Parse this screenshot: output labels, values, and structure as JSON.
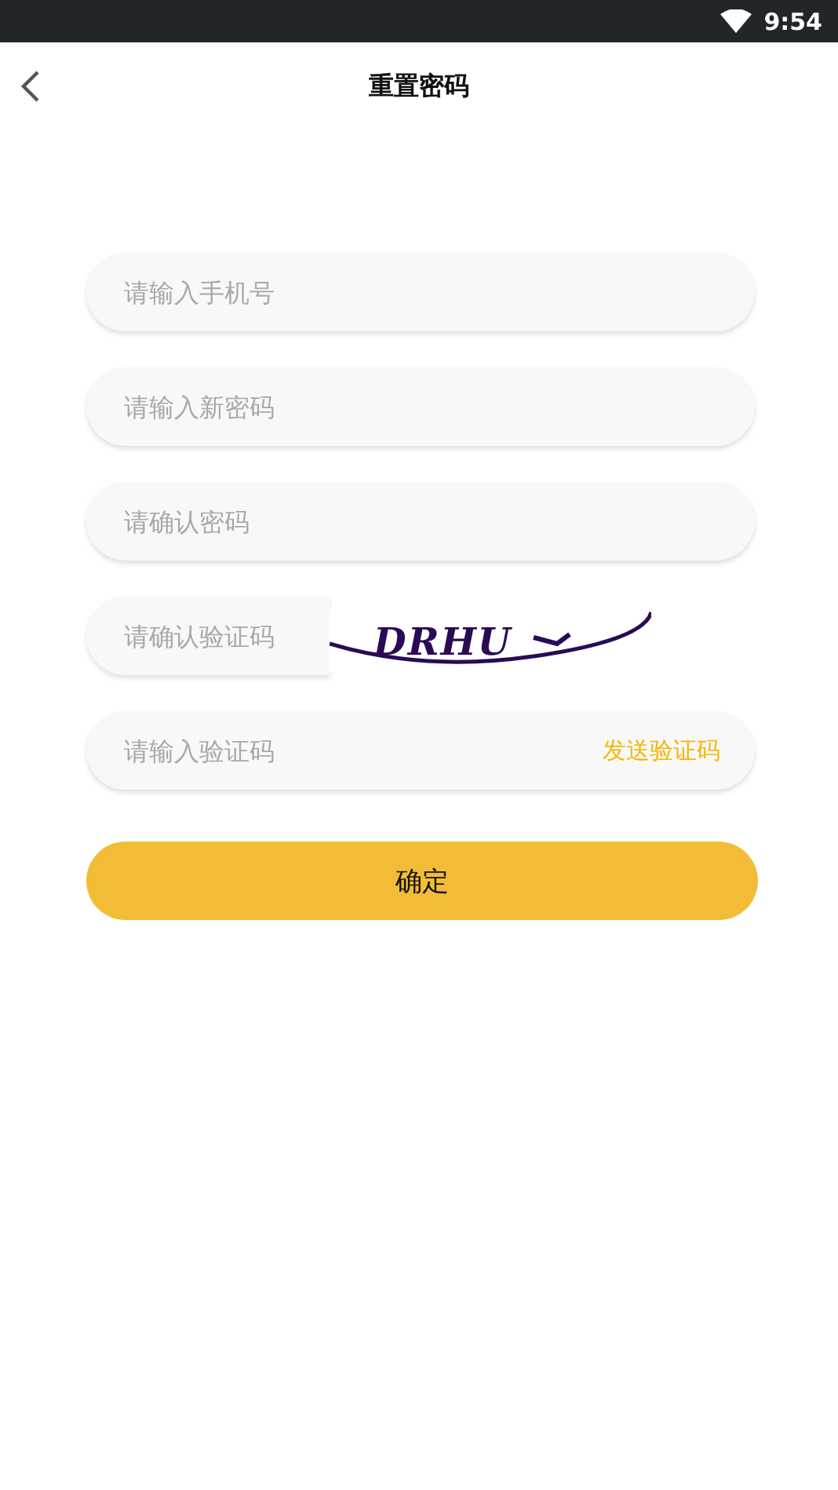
{
  "status_bar": {
    "time": "9:54"
  },
  "header": {
    "title": "重置密码"
  },
  "fields": [
    {
      "kind": "plain",
      "placeholder": "请输入手机号"
    },
    {
      "kind": "plain",
      "placeholder": "请输入新密码"
    },
    {
      "kind": "plain",
      "placeholder": "请确认密码"
    },
    {
      "kind": "captcha",
      "placeholder": "请确认验证码",
      "captcha": "DRHU"
    },
    {
      "kind": "sms",
      "placeholder": "请输入验证码",
      "action": "发送验证码"
    }
  ],
  "submit": "确定"
}
